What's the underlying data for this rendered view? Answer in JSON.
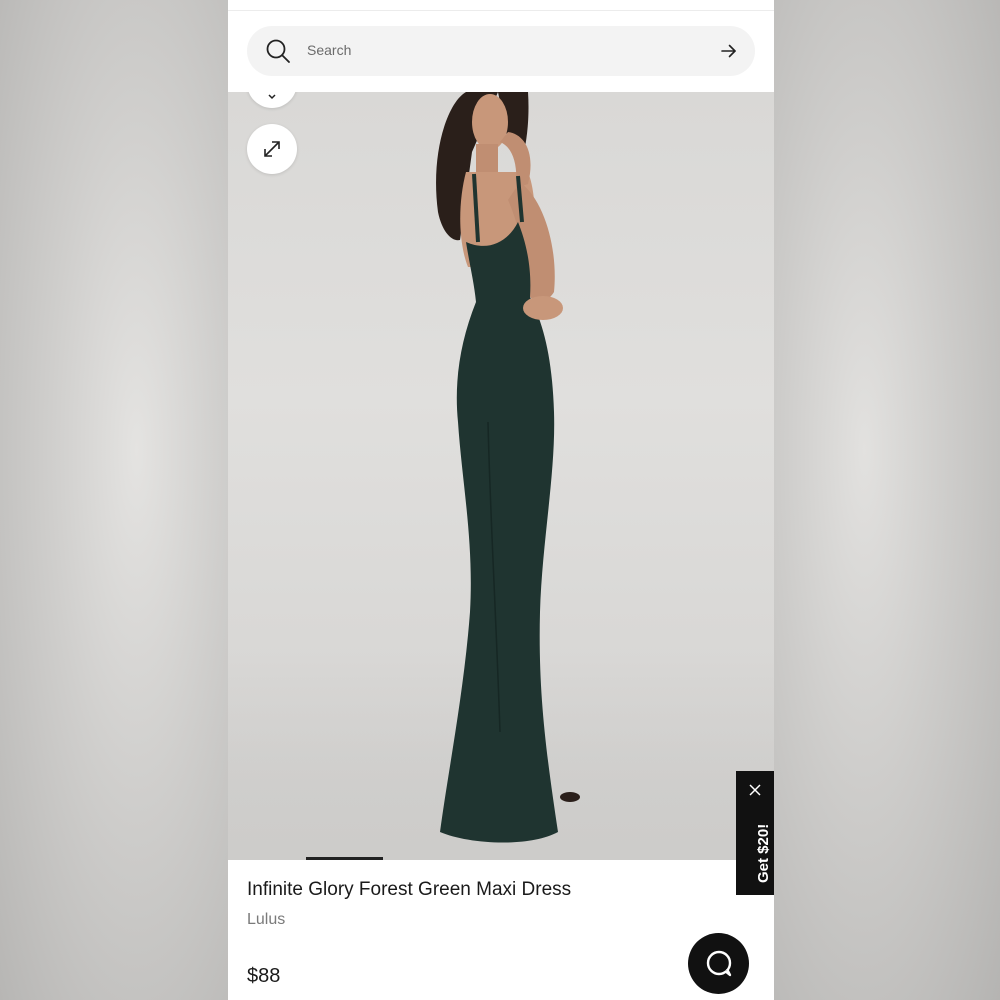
{
  "search": {
    "placeholder": "Search"
  },
  "product": {
    "title": "Infinite Glory Forest Green Maxi Dress",
    "brand": "Lulus",
    "price": "$88"
  },
  "promo": {
    "label": "Get $20!"
  },
  "icons": {
    "search": "search-icon",
    "submit": "arrow-right-icon",
    "expand": "expand-icon",
    "chevron": "chevron-down-icon",
    "close": "close-icon",
    "chat": "chat-bubble-icon"
  },
  "colors": {
    "dress": "#1f3430",
    "promo_bg": "#111111",
    "chat_bg": "#111111"
  }
}
